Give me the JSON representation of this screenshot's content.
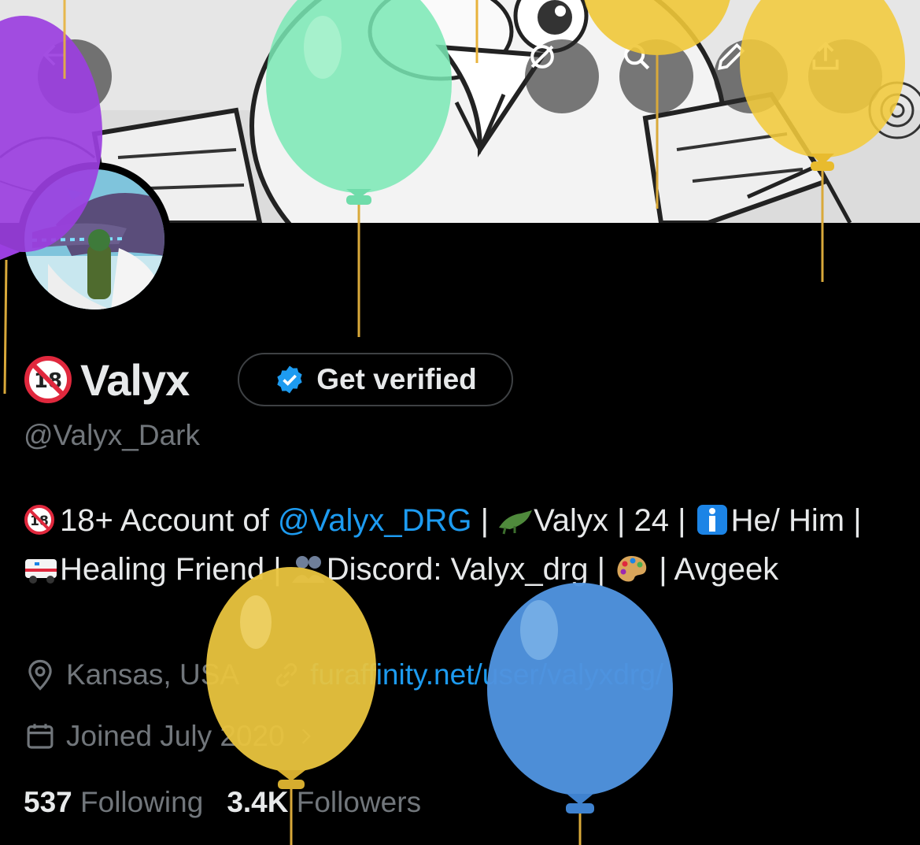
{
  "profile": {
    "display_name": "Valyx",
    "handle": "@Valyx_Dark",
    "get_verified_label": "Get verified",
    "bio": {
      "part1": "18+ Account of ",
      "mention": "@Valyx_DRG",
      "part2": " | ",
      "part3": "Valyx | 24 | ",
      "part4": "He/ Him | ",
      "part5": "Healing Friend | ",
      "part6": "Discord: Valyx_drg | ",
      "part7": " | Avgeek"
    },
    "location": "Kansas, USA",
    "website": "furaffinity.net/user/valyxdrg/",
    "joined": "Joined July 2020",
    "following_count": "537",
    "following_label": "Following",
    "followers_count": "3.4K",
    "followers_label": "Followers"
  },
  "icons": {
    "back": "back-arrow-icon",
    "grok": "grok-icon",
    "search": "search-icon",
    "edit": "pencil-icon",
    "share": "share-icon",
    "verified": "verified-badge-icon",
    "location": "location-pin-icon",
    "link": "link-icon",
    "calendar": "calendar-icon"
  },
  "colors": {
    "background": "#000000",
    "text_primary": "#e7e9ea",
    "text_secondary": "#71767b",
    "link": "#1d9bf0",
    "verified": "#1d9bf0"
  }
}
